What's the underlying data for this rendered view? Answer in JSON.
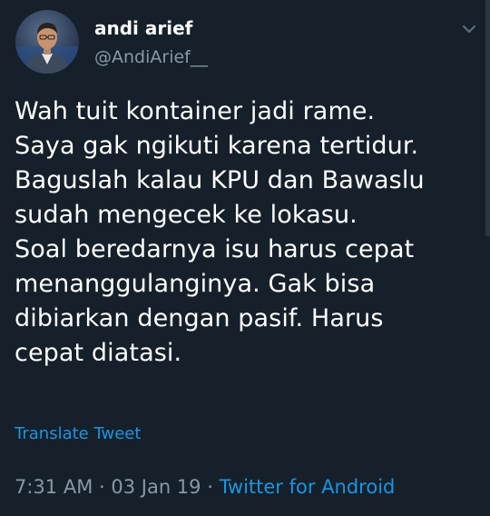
{
  "author": {
    "display_name": "andi arief",
    "handle": "@AndiArief__"
  },
  "tweet": {
    "text": "Wah tuit kontainer jadi rame.\nSaya gak ngikuti karena tertidur.\nBaguslah kalau KPU dan Bawaslu\nsudah mengecek ke lokasu.\nSoal beredarnya isu  harus cepat\nmenanggulanginya. Gak bisa\ndibiarkan dengan pasif. Harus\ncepat diatasi."
  },
  "translate_label": "Translate Tweet",
  "meta": {
    "time": "7:31 AM",
    "separator": " · ",
    "date": "03 Jan 19",
    "source": "Twitter for Android"
  },
  "icons": {
    "caret": "chevron-down-icon",
    "avatar": "avatar"
  },
  "colors": {
    "background": "#15202b",
    "secondary_text": "#8899a6",
    "link": "#1b95e0"
  }
}
